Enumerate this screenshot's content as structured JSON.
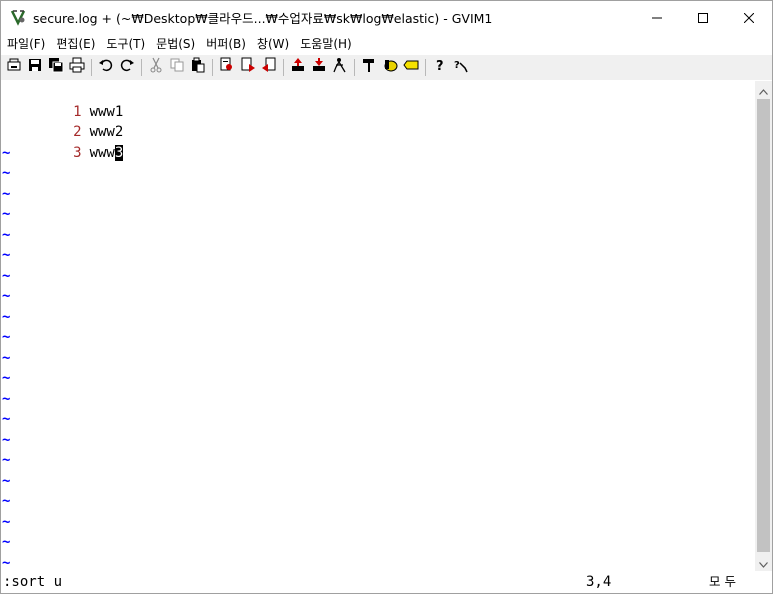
{
  "window": {
    "title": "secure.log + (~₩Desktop₩클라우드...₩수업자료₩sk₩log₩elastic) - GVIM1"
  },
  "menu": {
    "items": [
      {
        "label": "파일(F)"
      },
      {
        "label": "편집(E)"
      },
      {
        "label": "도구(T)"
      },
      {
        "label": "문법(S)"
      },
      {
        "label": "버퍼(B)"
      },
      {
        "label": "창(W)"
      },
      {
        "label": "도움말(H)"
      }
    ]
  },
  "toolbar": {
    "icons": [
      "open-icon",
      "save-icon",
      "save-all-icon",
      "print-icon",
      "undo-icon",
      "redo-icon",
      "cut-icon",
      "copy-icon",
      "paste-icon",
      "replace-icon",
      "find-next-icon",
      "find-prev-icon",
      "load-session-icon",
      "save-session-icon",
      "run-script-icon",
      "make-icon",
      "shell-icon",
      "tag-icon",
      "help-icon",
      "find-help-icon"
    ]
  },
  "editor": {
    "lines": [
      {
        "number": "1",
        "text": "www1"
      },
      {
        "number": "2",
        "text": "www2"
      },
      {
        "number": "3",
        "text": "www",
        "cursor_char": "3"
      }
    ],
    "tilde": "~",
    "line_color": "#a52a2a",
    "tilde_color": "#0000ff"
  },
  "statusline": {
    "command": ":sort u",
    "ruler": "3,4",
    "position": "모 두"
  }
}
